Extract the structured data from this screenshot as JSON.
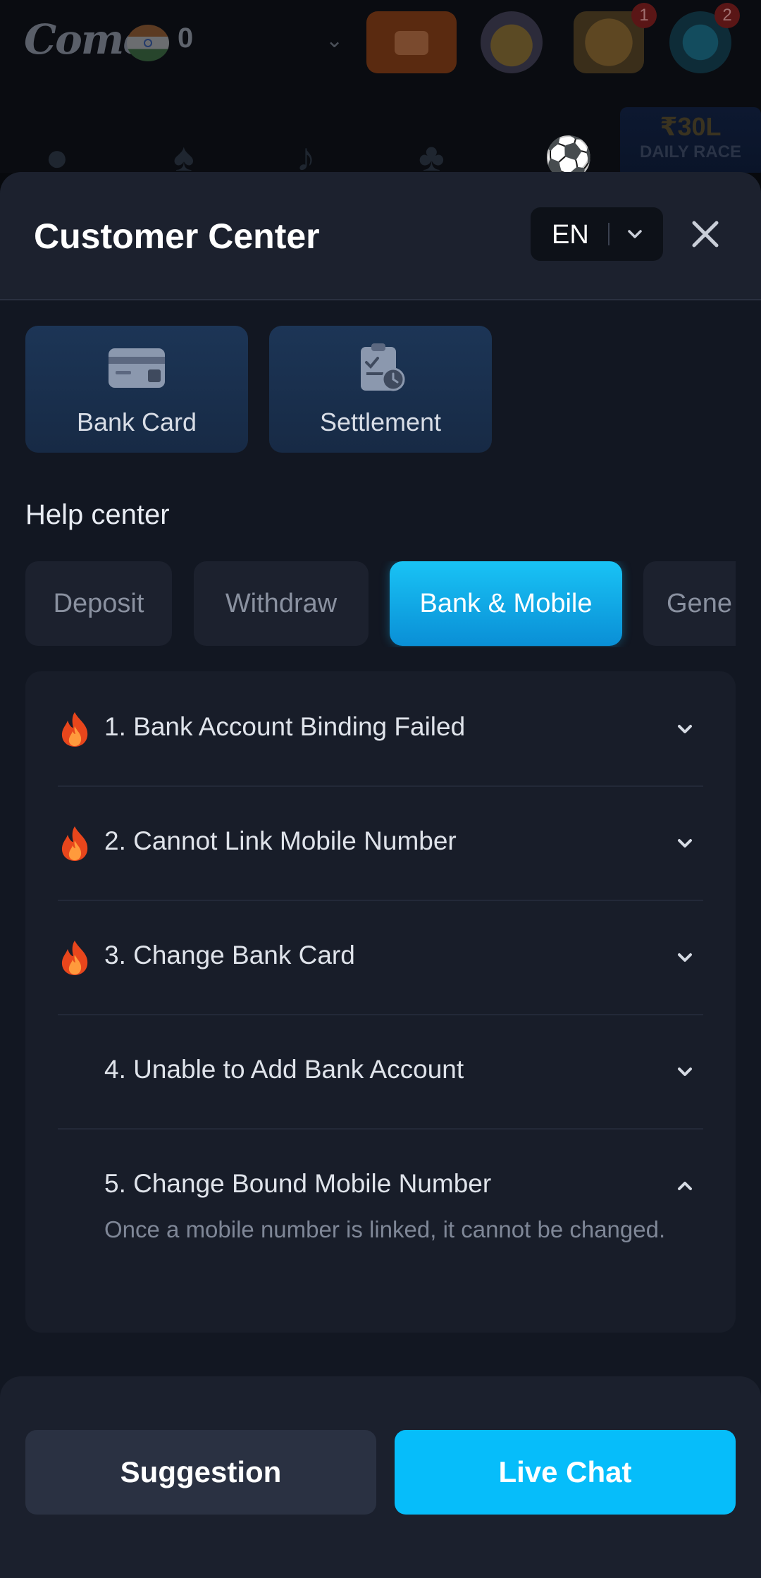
{
  "app": {
    "logo": "Come",
    "balance": "0"
  },
  "top_badges": {
    "gift_count": "1",
    "support_count": "2"
  },
  "race_banner": {
    "amount": "₹30L",
    "label": "DAILY RACE"
  },
  "header": {
    "title": "Customer Center",
    "language": "EN"
  },
  "service_cards": [
    {
      "label": "Bank Card",
      "icon": "bank-card-icon"
    },
    {
      "label": "Settlement",
      "icon": "settlement-clipboard-icon"
    }
  ],
  "help": {
    "title": "Help center",
    "tabs": [
      "Deposit",
      "Withdraw",
      "Bank & Mobile",
      "Gene"
    ],
    "active_tab": "Bank & Mobile"
  },
  "faq": [
    {
      "question": "1. Bank Account Binding Failed",
      "hot": true,
      "expanded": false
    },
    {
      "question": "2. Cannot Link Mobile Number",
      "hot": true,
      "expanded": false
    },
    {
      "question": "3. Change Bank Card",
      "hot": true,
      "expanded": false
    },
    {
      "question": "4. Unable to Add Bank Account",
      "hot": false,
      "expanded": false
    },
    {
      "question": "5. Change Bound Mobile Number",
      "hot": false,
      "expanded": true,
      "answer": "Once a mobile number is linked, it cannot be changed."
    }
  ],
  "footer": {
    "suggestion": "Suggestion",
    "live_chat": "Live Chat"
  },
  "colors": {
    "accent": "#06bdfa",
    "sheet_bg": "#121722",
    "card_bg": "#1c3556"
  }
}
